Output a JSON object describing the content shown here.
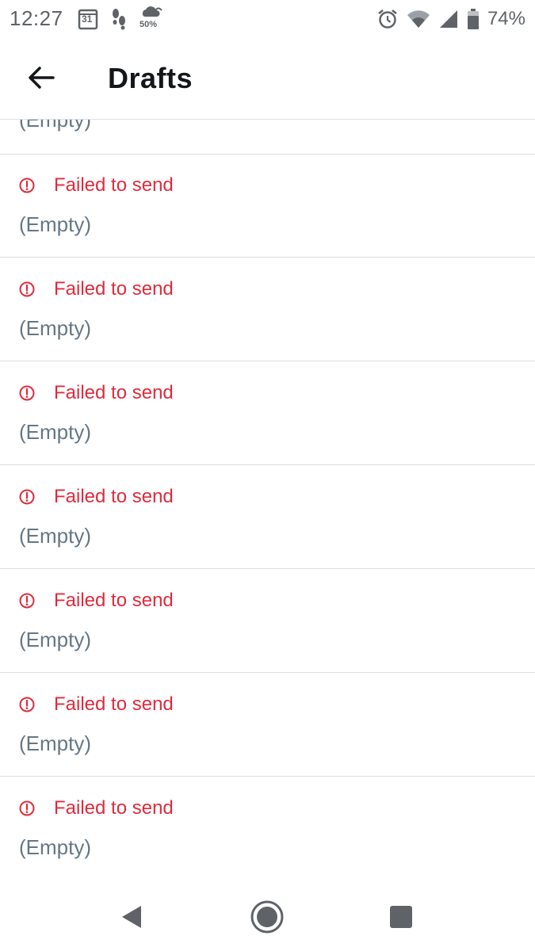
{
  "status_bar": {
    "time": "12:27",
    "calendar_day": "31",
    "weather_percent": "50%",
    "battery_percent": "74%"
  },
  "app_bar": {
    "title": "Drafts"
  },
  "drafts": {
    "partial_item": {
      "text": "(Empty)"
    },
    "items": [
      {
        "status": "Failed to send",
        "text": "(Empty)"
      },
      {
        "status": "Failed to send",
        "text": "(Empty)"
      },
      {
        "status": "Failed to send",
        "text": "(Empty)"
      },
      {
        "status": "Failed to send",
        "text": "(Empty)"
      },
      {
        "status": "Failed to send",
        "text": "(Empty)"
      },
      {
        "status": "Failed to send",
        "text": "(Empty)"
      },
      {
        "status": "Failed to send",
        "text": "(Empty)"
      }
    ]
  },
  "colors": {
    "error": "#e02b3c",
    "secondary_text": "#657786",
    "title_text": "#14171a",
    "divider": "#dadfe3"
  },
  "icons": {
    "back": "arrow-left-icon",
    "error": "error-circle-icon",
    "nav_back": "triangle-back-icon",
    "nav_home": "circle-home-icon",
    "nav_recents": "square-recents-icon"
  }
}
